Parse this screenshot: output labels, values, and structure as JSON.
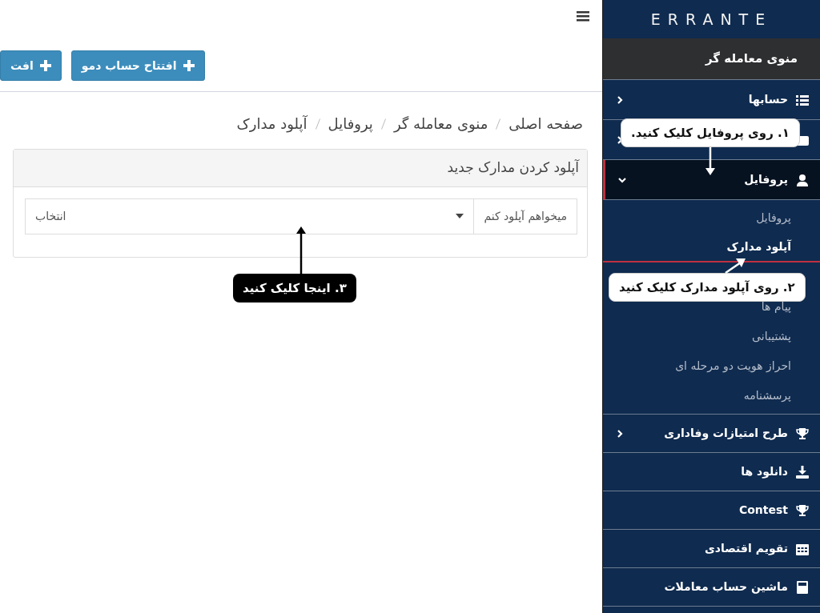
{
  "header": {
    "buttons": [
      {
        "label": "افتتاح حساب دمو"
      },
      {
        "label": "افت"
      }
    ]
  },
  "breadcrumb": [
    {
      "label": "صفحه اصلی"
    },
    {
      "label": "منوی معامله گر"
    },
    {
      "label": "پروفایل"
    },
    {
      "label": "آپلود مدارک"
    }
  ],
  "panel": {
    "title": "آپلود کردن مدارک جدید",
    "addon": "میخواهم آپلود کنم",
    "select_value": "انتخاب"
  },
  "sidebar": {
    "logo": "ERRANTE",
    "menu_title": "منوی معامله گر",
    "items": [
      {
        "label": "حسابها",
        "expanded": false,
        "selected": false
      },
      {
        "expanded": false,
        "selected": false
      },
      {
        "label": "پروفایل",
        "expanded": true,
        "selected": true,
        "children": [
          {
            "label": "پروفایل",
            "selected": false
          },
          {
            "label": "آپلود مدارک",
            "selected": true
          },
          {
            "label": "پیام ها",
            "selected": false
          },
          {
            "label": "پشتیبانی",
            "selected": false
          },
          {
            "label": "احراز هویت دو مرحله ای",
            "selected": false
          },
          {
            "label": "پرسشنامه",
            "selected": false
          }
        ]
      },
      {
        "label": "طرح امتیازات وفاداری",
        "expanded": false,
        "selected": false
      },
      {
        "label": "دانلود ها",
        "selected": false
      },
      {
        "label": "Contest",
        "selected": false
      },
      {
        "label": "تقویم اقتصادی",
        "selected": false
      },
      {
        "label": "ماشین حساب معاملات",
        "selected": false
      }
    ]
  },
  "annotations": [
    {
      "kind": "light",
      "text": "۱. روی پروفایل کلیک کنید."
    },
    {
      "kind": "light",
      "text": "۲. روی آپلود مدارک کلیک کنید"
    },
    {
      "kind": "dark",
      "text": "۳. اینجا کلیک کنید"
    }
  ]
}
